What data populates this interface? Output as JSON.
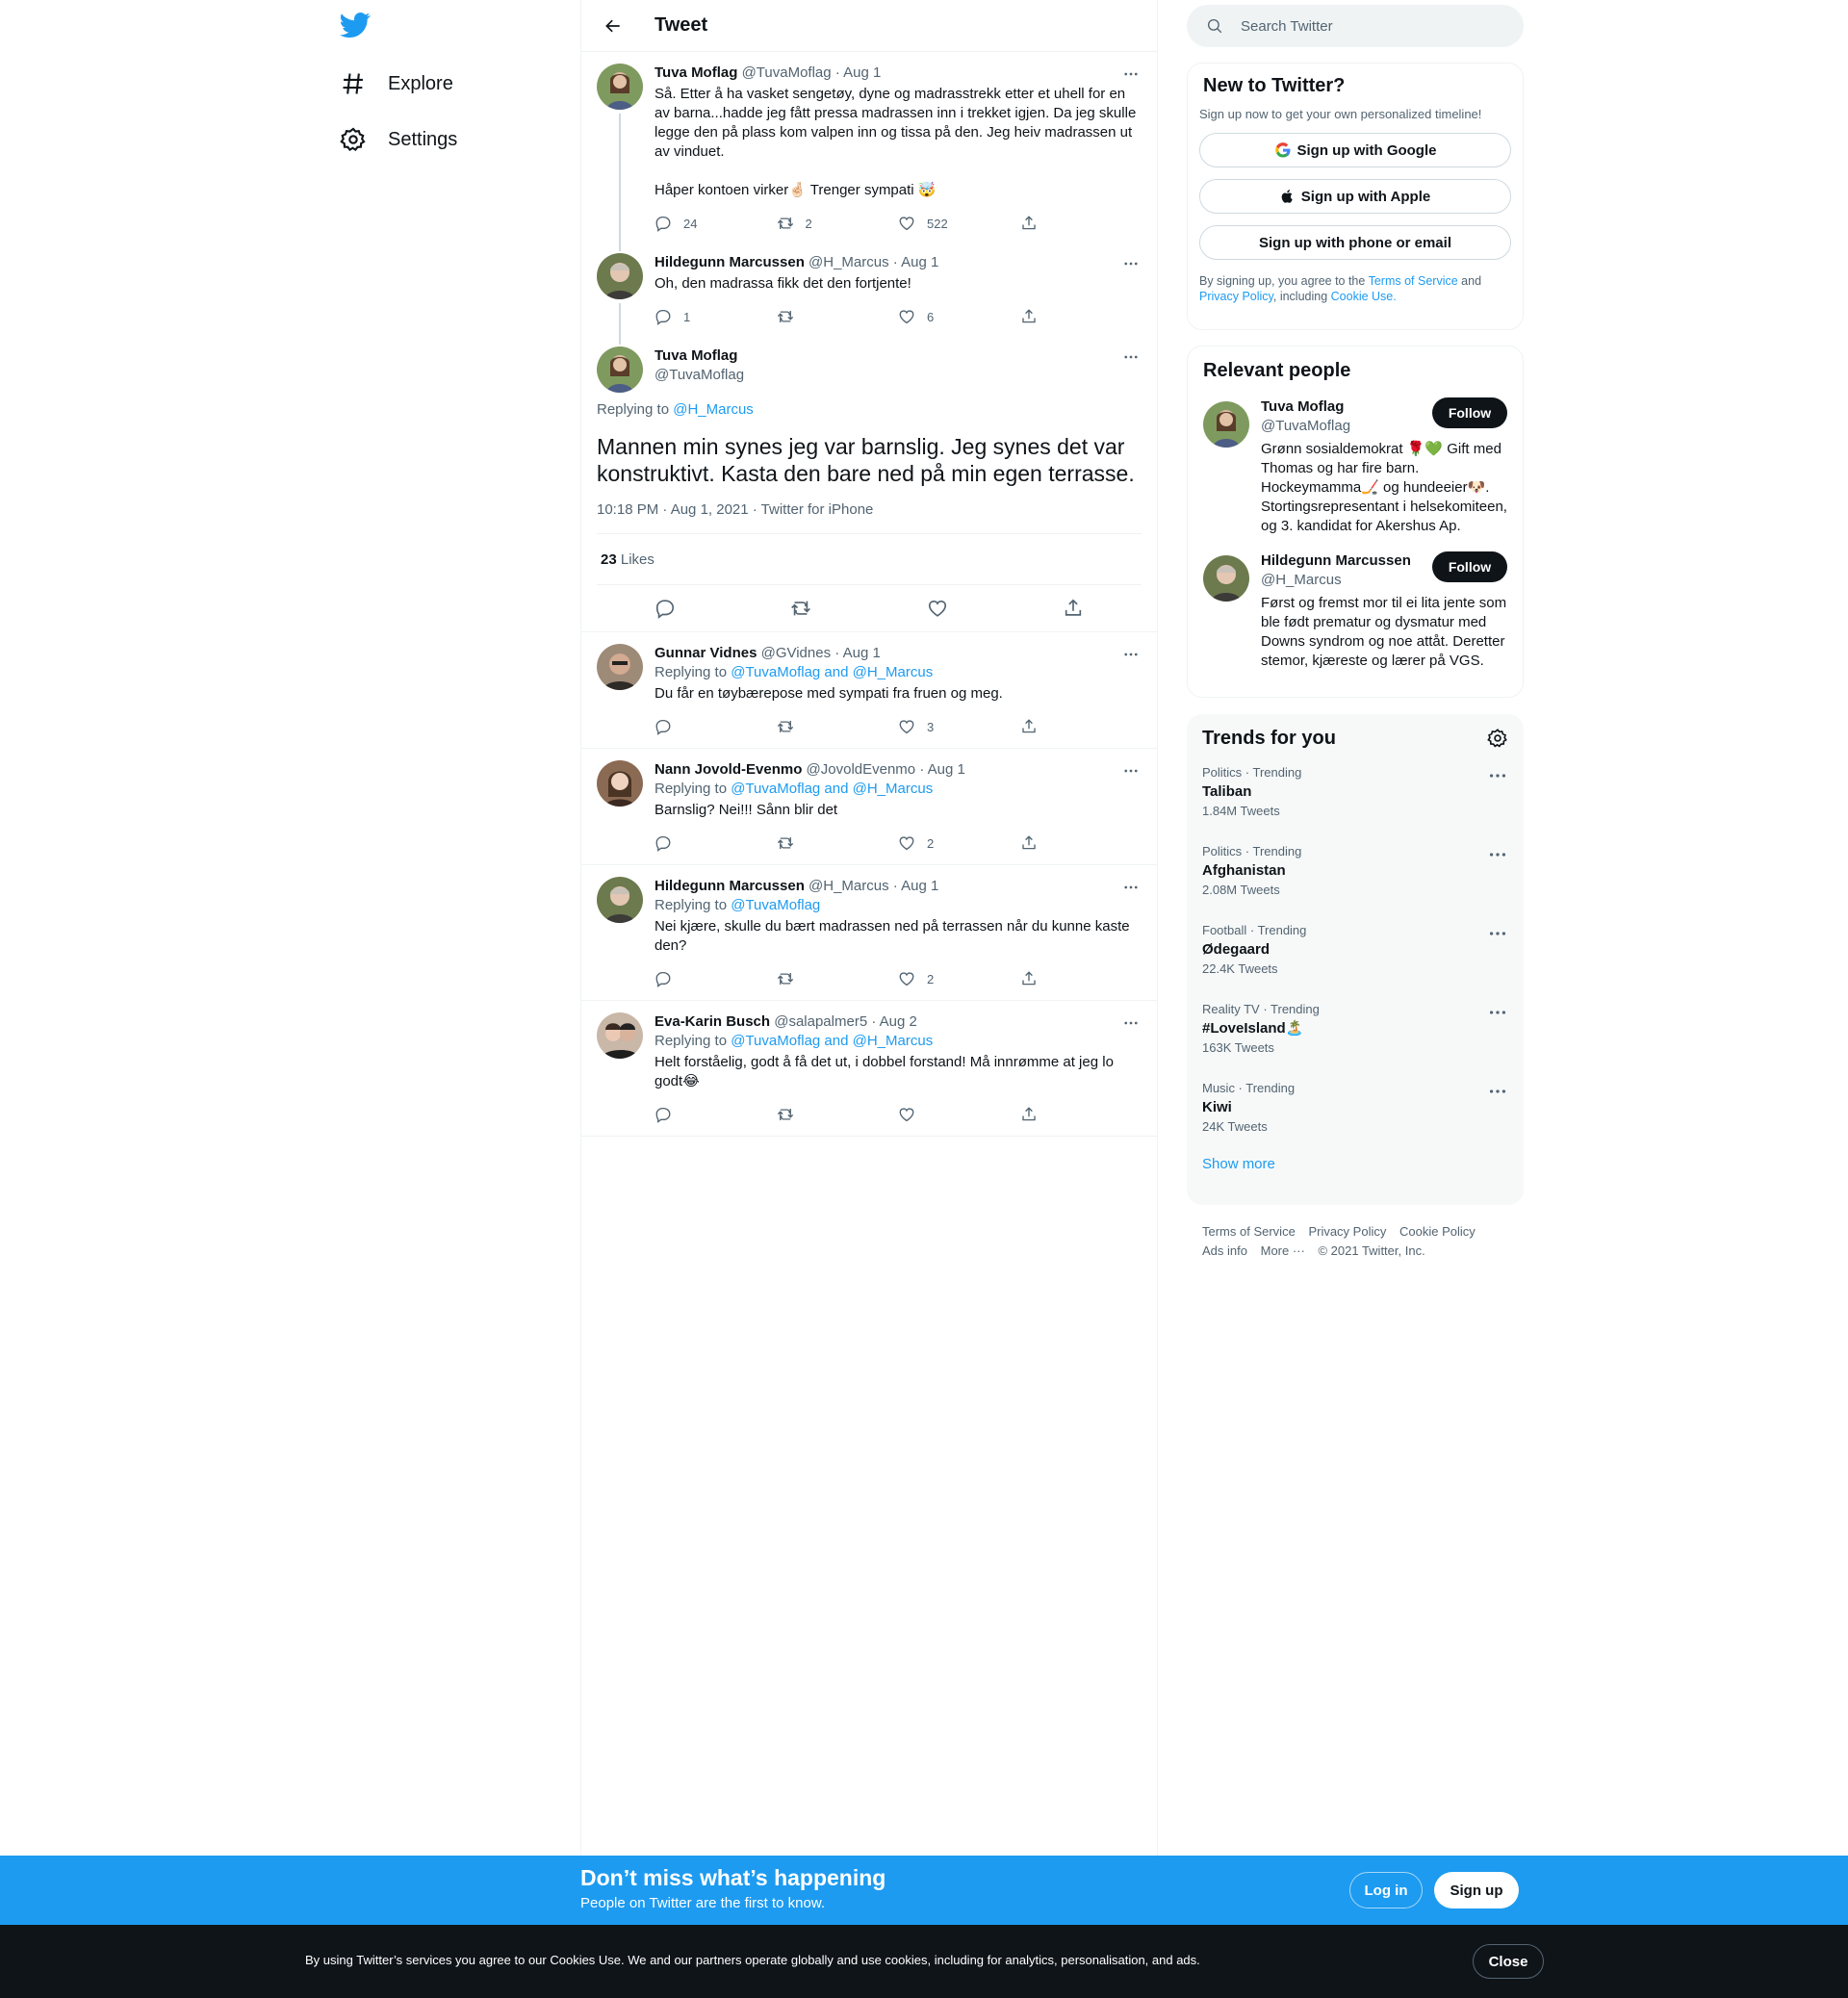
{
  "nav": {
    "items": [
      {
        "label": "Explore",
        "icon": "hashtag-icon"
      },
      {
        "label": "Settings",
        "icon": "gear-icon"
      }
    ]
  },
  "header": {
    "title": "Tweet"
  },
  "thread": [
    {
      "name": "Tuva Moflag",
      "handle": "@TuvaMoflag",
      "date": "· Aug 1",
      "text1": "Så. Etter å ha vasket sengetøy, dyne og madrasstrekk etter et uhell for en av barna...hadde jeg fått pressa madrassen inn i trekket igjen. Da jeg skulle legge den på plass kom valpen inn og tissa på den. Jeg heiv madrassen ut av vinduet.",
      "text2": "Håper kontoen virker🤞🏻 Trenger sympati 🤯",
      "replies": "24",
      "retweets": "2",
      "likes": "522"
    },
    {
      "name": "Hildegunn Marcussen",
      "handle": "@H_Marcus",
      "date": "· Aug 1",
      "text1": "Oh, den madrassa fikk det den fortjente!",
      "replies": "1",
      "retweets": "",
      "likes": "6"
    }
  ],
  "focus": {
    "name": "Tuva Moflag",
    "handle": "@TuvaMoflag",
    "replying_label": "Replying to",
    "replying_to": "@H_Marcus",
    "text": "Mannen min synes jeg var barnslig. Jeg synes det var konstruktivt. Kasta den bare ned på min egen terrasse.",
    "timestamp": "10:18 PM · Aug 1, 2021 · Twitter for iPhone",
    "likes_count": "23",
    "likes_label": "Likes"
  },
  "replies": [
    {
      "name": "Gunnar Vidnes",
      "handle": "@GVidnes",
      "date": "· Aug 1",
      "replying_label": "Replying to",
      "replying_to": "@TuvaMoflag and @H_Marcus",
      "text": "Du får en tøybærepose med sympati fra fruen og meg.",
      "replies": "",
      "retweets": "",
      "likes": "3"
    },
    {
      "name": "Nann Jovold-Evenmo",
      "handle": "@JovoldEvenmo",
      "date": "· Aug 1",
      "replying_label": "Replying to",
      "replying_to": "@TuvaMoflag and @H_Marcus",
      "text": "Barnslig? Nei!!! Sånn blir det",
      "replies": "",
      "retweets": "",
      "likes": "2"
    },
    {
      "name": "Hildegunn Marcussen",
      "handle": "@H_Marcus",
      "date": "· Aug 1",
      "replying_label": "Replying to",
      "replying_to": "@TuvaMoflag",
      "text": "Nei kjære, skulle du bært madrassen  ned på terrassen når du kunne kaste den?",
      "replies": "",
      "retweets": "",
      "likes": "2"
    },
    {
      "name": "Eva-Karin Busch",
      "handle": "@salapalmer5",
      "date": "· Aug 2",
      "replying_label": "Replying to",
      "replying_to": "@TuvaMoflag and @H_Marcus",
      "text": "Helt forståelig, godt å få det ut, i dobbel forstand! Må innrømme at jeg lo godt😂",
      "replies": "",
      "retweets": "",
      "likes": ""
    }
  ],
  "search": {
    "placeholder": "Search Twitter"
  },
  "new_to_twitter": {
    "title": "New to Twitter?",
    "subtitle": "Sign up now to get your own personalized timeline!",
    "google": "Sign up with Google",
    "apple": "Sign up with Apple",
    "phone": "Sign up with phone or email",
    "legal_1": "By signing up, you agree to the ",
    "tos": "Terms of Service",
    "legal_2": " and ",
    "privacy": "Privacy Policy",
    "legal_3": ", including ",
    "cookie": "Cookie Use."
  },
  "relevant": {
    "title": "Relevant people",
    "follow_label": "Follow",
    "people": [
      {
        "name": "Tuva Moflag",
        "handle": "@TuvaMoflag",
        "bio": "Grønn sosialdemokrat 🌹💚 Gift med Thomas og har fire barn. Hockeymamma🏒 og hundeeier🐶. Stortingsrepresentant i helsekomiteen, og 3. kandidat for Akershus Ap."
      },
      {
        "name": "Hildegunn Marcussen",
        "handle": "@H_Marcus",
        "bio": "Først og fremst mor til ei lita jente som ble født prematur og dysmatur med Downs syndrom og noe attåt. Deretter stemor, kjæreste og lærer på VGS."
      }
    ]
  },
  "trends": {
    "title": "Trends for you",
    "items": [
      {
        "category": "Politics · Trending",
        "name": "Taliban",
        "count": "1.84M Tweets"
      },
      {
        "category": "Politics · Trending",
        "name": "Afghanistan",
        "count": "2.08M Tweets"
      },
      {
        "category": "Football · Trending",
        "name": "Ødegaard",
        "count": "22.4K Tweets"
      },
      {
        "category": "Reality TV · Trending",
        "name": "#LoveIsland🏝️",
        "count": "163K Tweets"
      },
      {
        "category": "Music · Trending",
        "name": "Kiwi",
        "count": "24K Tweets"
      }
    ],
    "show_more": "Show more"
  },
  "footer": {
    "links": [
      "Terms of Service",
      "Privacy Policy",
      "Cookie Policy",
      "Ads info",
      "More ···",
      "© 2021 Twitter, Inc."
    ]
  },
  "banner": {
    "headline": "Don’t miss what’s happening",
    "sub": "People on Twitter are the first to know.",
    "login": "Log in",
    "signup": "Sign up"
  },
  "cookie_bar": {
    "text": "By using Twitter’s services you agree to our Cookies Use. We and our partners operate globally and use cookies, including for analytics, personalisation, and ads.",
    "close": "Close"
  },
  "colors": {
    "accent": "#1d9bf0",
    "text": "#0f1419",
    "muted": "#536471",
    "border": "#eff3f4",
    "cookie_bg": "#0f1419"
  }
}
